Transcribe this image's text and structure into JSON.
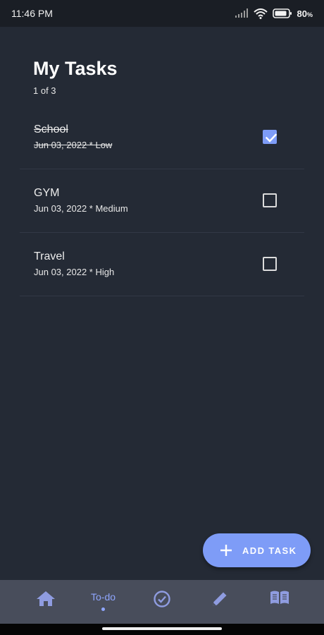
{
  "status": {
    "time": "11:46 PM",
    "battery": "80",
    "battery_unit": "%"
  },
  "header": {
    "title": "My Tasks",
    "count": "1 of 3"
  },
  "tasks": [
    {
      "name": "School",
      "meta": "Jun 03, 2022 * Low",
      "done": true
    },
    {
      "name": "GYM",
      "meta": "Jun 03, 2022 * Medium",
      "done": false
    },
    {
      "name": "Travel",
      "meta": "Jun 03, 2022 * High",
      "done": false
    }
  ],
  "fab": {
    "label": "ADD TASK",
    "icon": "plus-icon"
  },
  "nav": {
    "items": [
      {
        "icon": "home-icon"
      },
      {
        "label": "To-do",
        "active": true
      },
      {
        "icon": "check-circle-icon"
      },
      {
        "icon": "pencil-icon"
      },
      {
        "icon": "book-open-icon"
      }
    ]
  },
  "colors": {
    "background": "#242a35",
    "accent": "#7e9cf7",
    "nav": "#484d5b"
  }
}
